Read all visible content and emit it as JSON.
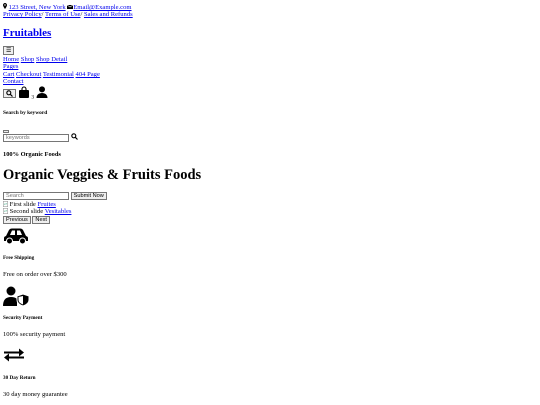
{
  "topbar": {
    "address": "123 Street, New York",
    "email": "Email@Example.com",
    "links": [
      "Privacy Policy",
      "Terms of Use",
      "Sales and Refunds"
    ],
    "sep": "/"
  },
  "brand": "Fruitables",
  "nav": {
    "toggle": "☰",
    "row1": [
      "Home",
      "Shop",
      "Shop Detail"
    ],
    "pages": "Pages",
    "row2": [
      "Cart",
      "Checkout",
      "Testimonial",
      "404 Page"
    ],
    "contact": "Contact",
    "cart_count": "3"
  },
  "search_modal": {
    "title": "Search by keyword",
    "placeholder": "keywords"
  },
  "hero": {
    "subtitle": "100% Organic Foods",
    "title": "Organic Veggies & Fruits Foods",
    "search_placeholder": "Search",
    "submit": "Submit Now",
    "slide1_alt": "First slide",
    "slide1_link": "Fruites",
    "slide2_alt": "Second slide",
    "slide2_link": "Vesitables",
    "prev": "Previous",
    "next": "Next"
  },
  "features": [
    {
      "icon": "car-icon",
      "title": "Free Shipping",
      "text": "Free on order over $300"
    },
    {
      "icon": "user-shield-icon",
      "title": "Security Payment",
      "text": "100% security payment"
    },
    {
      "icon": "exchange-icon",
      "title": "30 Day Return",
      "text": "30 day money guarantee"
    }
  ]
}
